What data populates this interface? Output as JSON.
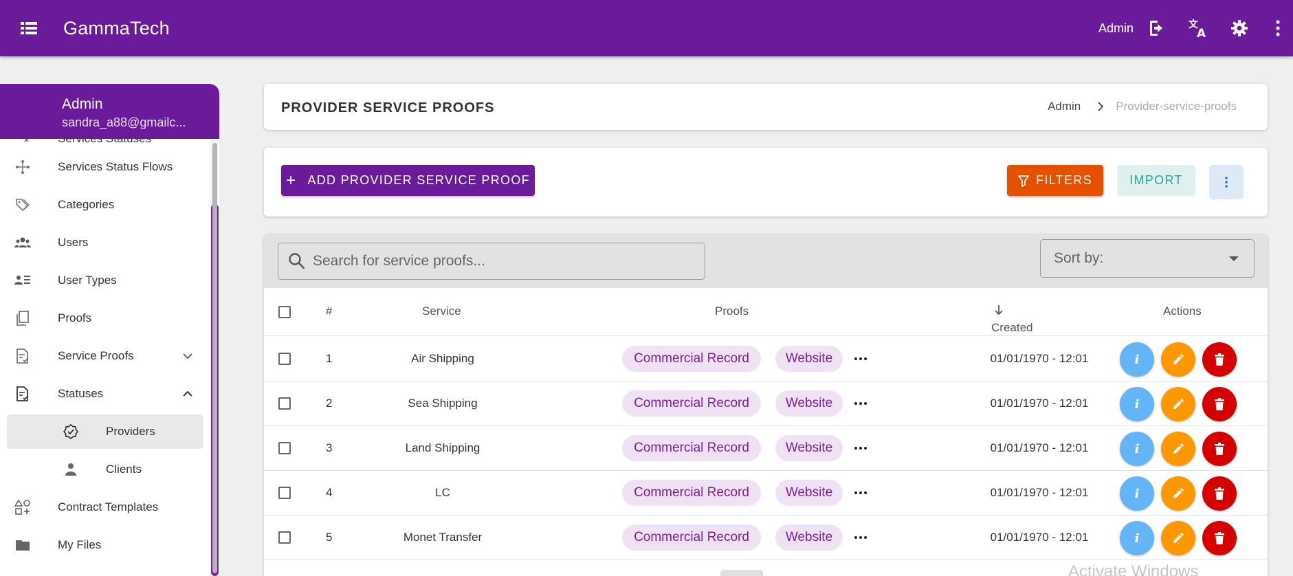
{
  "topbar": {
    "brand": "GammaTech",
    "user_label": "Admin",
    "icons": [
      "menu-icon",
      "logout-icon",
      "translate-icon",
      "gear-icon",
      "more-vert-icon"
    ]
  },
  "sidebar": {
    "profile": {
      "name": "Admin",
      "email": "sandra_a88@gmailc..."
    },
    "items": [
      {
        "label": "Services Statuses",
        "icon": "status-icon"
      },
      {
        "label": "Services Status Flows",
        "icon": "flow-icon"
      },
      {
        "label": "Categories",
        "icon": "tags-icon"
      },
      {
        "label": "Users",
        "icon": "users-icon"
      },
      {
        "label": "User Types",
        "icon": "user-types-icon"
      },
      {
        "label": "Proofs",
        "icon": "documents-icon"
      },
      {
        "label": "Service Proofs",
        "icon": "document-check-icon",
        "expanded": false
      },
      {
        "label": "Statuses",
        "icon": "document-check-icon",
        "expanded": true
      },
      {
        "label": "Providers",
        "icon": "badge-check-icon",
        "active": true
      },
      {
        "label": "Clients",
        "icon": "person-icon"
      },
      {
        "label": "Contract Templates",
        "icon": "shapes-icon"
      },
      {
        "label": "My Files",
        "icon": "folder-icon"
      }
    ]
  },
  "header": {
    "title": "PROVIDER SERVICE PROOFS",
    "breadcrumb": [
      "Admin",
      "Provider-service-proofs"
    ]
  },
  "toolbar": {
    "add_label": "ADD PROVIDER SERVICE PROOF",
    "filters_label": "FILTERS",
    "import_label": "IMPORT"
  },
  "table": {
    "search_placeholder": "Search for service proofs...",
    "sort_label": "Sort by:",
    "columns": [
      "#",
      "Service",
      "Proofs",
      "Created",
      "Actions"
    ],
    "rows": [
      {
        "num": "1",
        "service": "Air Shipping",
        "proofs": [
          "Commercial Record",
          "Website"
        ],
        "created": "01/01/1970 - 12:01"
      },
      {
        "num": "2",
        "service": "Sea Shipping",
        "proofs": [
          "Commercial Record",
          "Website"
        ],
        "created": "01/01/1970 - 12:01"
      },
      {
        "num": "3",
        "service": "Land Shipping",
        "proofs": [
          "Commercial Record",
          "Website"
        ],
        "created": "01/01/1970 - 12:01"
      },
      {
        "num": "4",
        "service": "LC",
        "proofs": [
          "Commercial Record",
          "Website"
        ],
        "created": "01/01/1970 - 12:01"
      },
      {
        "num": "5",
        "service": "Monet Transfer",
        "proofs": [
          "Commercial Record",
          "Website"
        ],
        "created": "01/01/1970 - 12:01"
      }
    ]
  },
  "colors": {
    "primary": "#6a1b9a",
    "filters": "#e65100",
    "import_text": "#26a69a",
    "info": "#64b5f6",
    "edit": "#ff9800",
    "delete": "#d50000",
    "chip_bg": "#efe2f3",
    "chip_text": "#7b1fa2"
  },
  "watermark": "Activate Windows"
}
